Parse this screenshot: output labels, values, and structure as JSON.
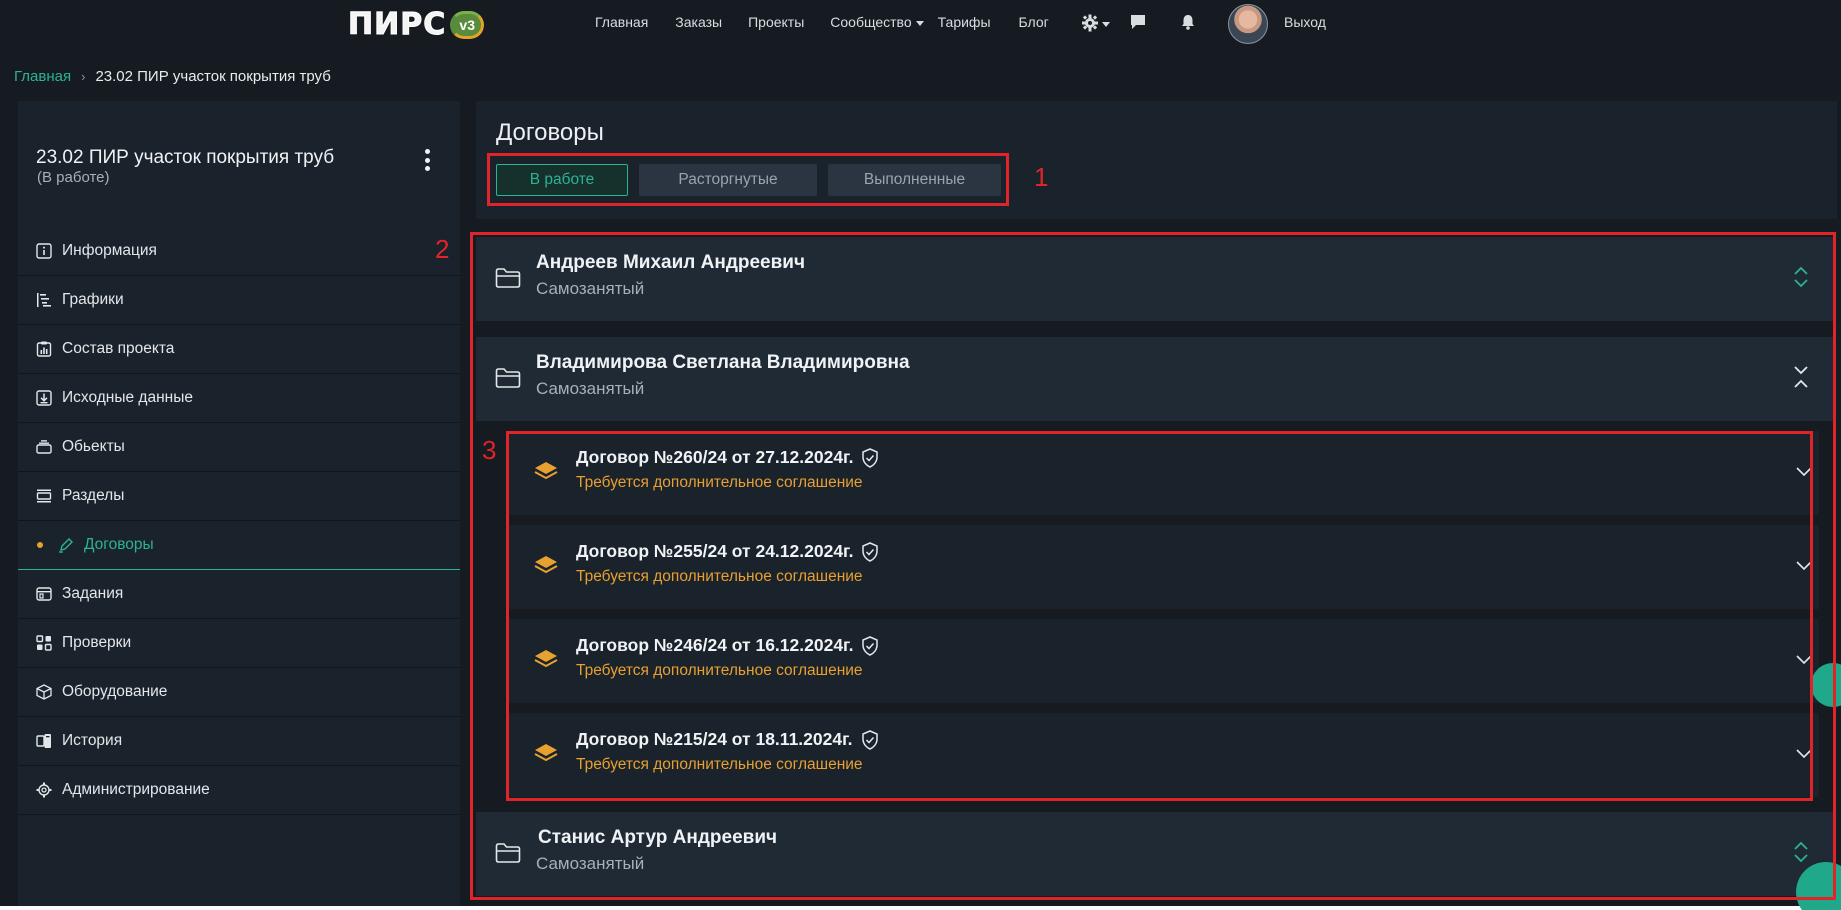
{
  "logo": {
    "text": "ПИРС",
    "badge": "v3"
  },
  "nav": {
    "items": [
      "Главная",
      "Заказы",
      "Проекты",
      "Сообщество",
      "Тарифы",
      "Блог"
    ],
    "logout": "Выход"
  },
  "breadcrumb": {
    "home": "Главная",
    "current": "23.02  ПИР участок покрытия труб"
  },
  "project": {
    "title": "23.02 ПИР участок покрытия  труб",
    "status": "(В работе)"
  },
  "sidebar": {
    "items": [
      {
        "label": "Информация",
        "icon": "info-icon"
      },
      {
        "label": "Графики",
        "icon": "gantt-icon"
      },
      {
        "label": "Состав проекта",
        "icon": "chart-icon"
      },
      {
        "label": "Исходные данные",
        "icon": "download-icon"
      },
      {
        "label": "Обьекты",
        "icon": "layers-icon"
      },
      {
        "label": "Разделы",
        "icon": "sections-icon"
      },
      {
        "label": "Договоры",
        "icon": "pen-icon",
        "active": true
      },
      {
        "label": "Задания",
        "icon": "tasks-icon"
      },
      {
        "label": "Проверки",
        "icon": "grid-icon"
      },
      {
        "label": "Оборудование",
        "icon": "box-icon"
      },
      {
        "label": "История",
        "icon": "history-icon"
      },
      {
        "label": "Администрирование",
        "icon": "gear-icon"
      }
    ]
  },
  "main": {
    "title": "Договоры",
    "tabs": [
      "В работе",
      "Расторгнутые",
      "Выполненные"
    ],
    "active_tab": "В работе"
  },
  "contractors": [
    {
      "name": "Андреев Михаил Андреевич",
      "type": "Самозанятый",
      "expanded": false
    },
    {
      "name": "Владимирова Светлана Владимировна",
      "type": "Самозанятый",
      "expanded": true
    },
    {
      "name": "Станис Артур  Андреевич",
      "type": "Самозанятый",
      "expanded": false
    }
  ],
  "contracts": [
    {
      "title": "Договор №260/24 от 27.12.2024г.",
      "status": "Требуется дополнительное соглашение"
    },
    {
      "title": "Договор №255/24 от 24.12.2024г.",
      "status": "Требуется дополнительное соглашение"
    },
    {
      "title": "Договор №246/24 от 16.12.2024г.",
      "status": "Требуется дополнительное соглашение"
    },
    {
      "title": "Договор №215/24 от 18.11.2024г.",
      "status": "Требуется дополнительное соглашение"
    }
  ],
  "annotations": [
    "1",
    "2",
    "3"
  ],
  "colors": {
    "accent": "#2bb394",
    "warning": "#e8a030",
    "annotation": "#e0242a",
    "background": "#151b21"
  }
}
